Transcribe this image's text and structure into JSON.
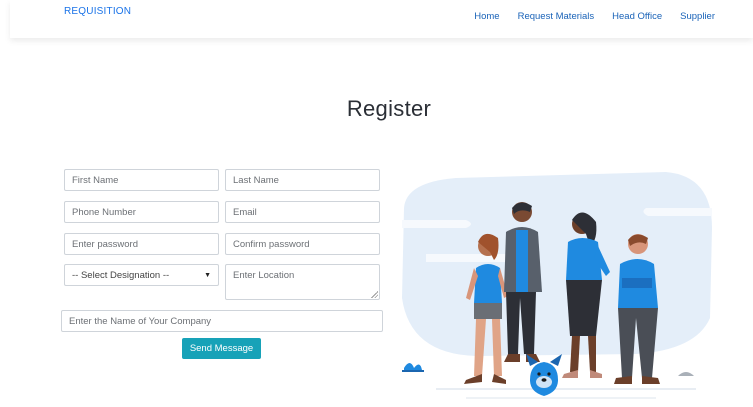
{
  "nav": {
    "brand": "REQUISITION",
    "links": [
      "Home",
      "Request Materials",
      "Head Office",
      "Supplier"
    ]
  },
  "page": {
    "title": "Register"
  },
  "form": {
    "first_name_placeholder": "First Name",
    "last_name_placeholder": "Last Name",
    "phone_placeholder": "Phone Number",
    "email_placeholder": "Email",
    "password_placeholder": "Enter password",
    "confirm_password_placeholder": "Confirm password",
    "designation_selected": "-- Select Designation --",
    "location_placeholder": "Enter Location",
    "company_placeholder": "Enter the Name of Your Company",
    "submit_label": "Send Message"
  },
  "colors": {
    "link": "#1a63b8",
    "button": "#17a2b8",
    "illustration_bg": "#e4eef9",
    "people_shirt": "#1f8ae0"
  }
}
